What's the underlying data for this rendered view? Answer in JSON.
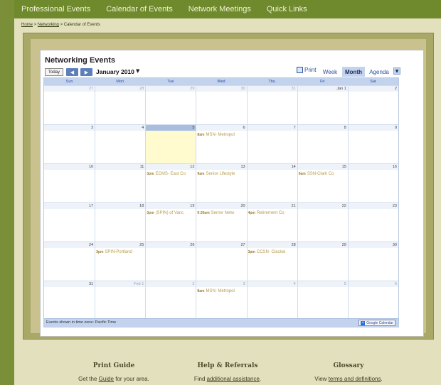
{
  "topnav": {
    "items": [
      "Professional Events",
      "Calendar of Events",
      "Network Meetings",
      "Quick Links"
    ]
  },
  "breadcrumb": {
    "home": "Home",
    "sep1": ">",
    "networking": "Networking",
    "sep2": ">",
    "current": "Calendar of Events"
  },
  "calendar": {
    "title": "Networking Events",
    "today_label": "Today",
    "prev_icon": "chevron-left-icon",
    "next_icon": "chevron-right-icon",
    "month_label": "January 2010",
    "print_label": "Print",
    "tabs": [
      {
        "label": "Week",
        "active": false
      },
      {
        "label": "Month",
        "active": true
      },
      {
        "label": "Agenda",
        "active": false
      }
    ],
    "days_of_week": [
      "Sun",
      "Mon",
      "Tue",
      "Wed",
      "Thu",
      "Fri",
      "Sat"
    ],
    "weeks": [
      [
        {
          "n": "27",
          "other": true
        },
        {
          "n": "28",
          "other": true
        },
        {
          "n": "29",
          "other": true
        },
        {
          "n": "30",
          "other": true
        },
        {
          "n": "31",
          "other": true
        },
        {
          "n": "Jan 1"
        },
        {
          "n": "2"
        }
      ],
      [
        {
          "n": "3"
        },
        {
          "n": "4"
        },
        {
          "n": "5",
          "today": true
        },
        {
          "n": "6",
          "events": [
            {
              "time": "8am",
              "text": "MSN- Metropol"
            }
          ]
        },
        {
          "n": "7"
        },
        {
          "n": "8"
        },
        {
          "n": "9"
        }
      ],
      [
        {
          "n": "10"
        },
        {
          "n": "11"
        },
        {
          "n": "12",
          "events": [
            {
              "time": "3pm",
              "text": "ECMS- East Co"
            }
          ]
        },
        {
          "n": "13",
          "events": [
            {
              "time": "9am",
              "text": "Senior Lifestyle"
            }
          ]
        },
        {
          "n": "14"
        },
        {
          "n": "15",
          "events": [
            {
              "time": "9am",
              "text": "SSN-Clark Co"
            }
          ]
        },
        {
          "n": "16"
        }
      ],
      [
        {
          "n": "17"
        },
        {
          "n": "18"
        },
        {
          "n": "19",
          "events": [
            {
              "time": "3pm",
              "text": "(SPIN) of Vanc"
            }
          ]
        },
        {
          "n": "20",
          "events": [
            {
              "time": "9:30am",
              "text": "Senior Netw"
            }
          ]
        },
        {
          "n": "21",
          "events": [
            {
              "time": "4pm",
              "text": "Retirement Co"
            }
          ]
        },
        {
          "n": "22"
        },
        {
          "n": "23"
        }
      ],
      [
        {
          "n": "24"
        },
        {
          "n": "25",
          "events": [
            {
              "time": "3pm",
              "text": "SPIN-Portland"
            }
          ]
        },
        {
          "n": "26"
        },
        {
          "n": "27"
        },
        {
          "n": "28",
          "events": [
            {
              "time": "3pm",
              "text": "CCSN- Clackai"
            }
          ]
        },
        {
          "n": "29"
        },
        {
          "n": "30"
        }
      ],
      [
        {
          "n": "31"
        },
        {
          "n": "Feb 1",
          "other": true
        },
        {
          "n": "2",
          "other": true
        },
        {
          "n": "3",
          "other": true,
          "events": [
            {
              "time": "8am",
              "text": "MSN- Metropol"
            }
          ]
        },
        {
          "n": "4",
          "other": true
        },
        {
          "n": "5",
          "other": true
        },
        {
          "n": "6",
          "other": true
        }
      ]
    ],
    "timezone_note": "Events shown in time zone: Pacific Time",
    "gcal_badge": "Google Calendar"
  },
  "bottom": {
    "print_guide": {
      "title": "Print Guide",
      "pre": "Get the ",
      "link": "Guide",
      "post": " for your area."
    },
    "help": {
      "title": "Help & Referrals",
      "pre": "Find ",
      "link": "additional assistance",
      "post": "."
    },
    "glossary": {
      "title": "Glossary",
      "pre": "View ",
      "link": "terms and definitions",
      "post": "."
    }
  },
  "colors": {
    "nav_bg": "#6f8a2c",
    "accent_blue": "#c3d3ee",
    "event_text": "#b89a4a",
    "today_bg": "#fffbcf"
  }
}
